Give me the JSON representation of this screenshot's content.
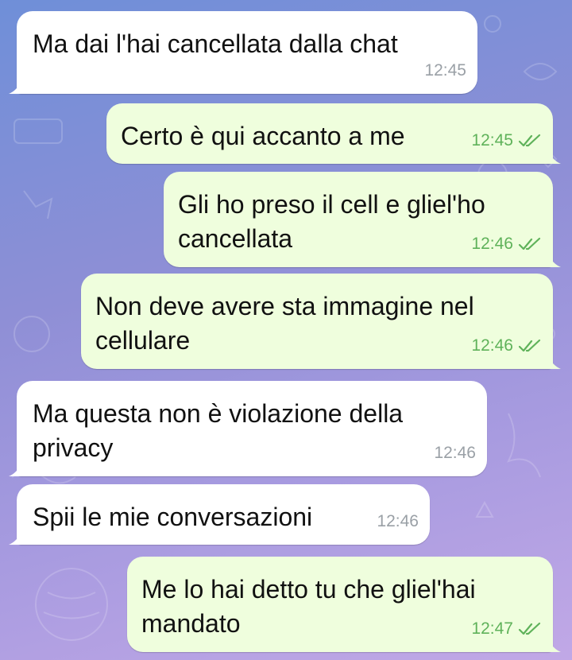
{
  "chat": {
    "messages": [
      {
        "id": "m1",
        "direction": "incoming",
        "text": "Ma dai l'hai cancellata dalla chat",
        "time": "12:45"
      },
      {
        "id": "m2",
        "direction": "outgoing",
        "text": "Certo è qui accanto a me",
        "time": "12:45",
        "status_icon": "double-check-icon"
      },
      {
        "id": "m3",
        "direction": "outgoing",
        "text": "Gli ho preso il cell e gliel'ho cancellata",
        "time": "12:46",
        "status_icon": "double-check-icon"
      },
      {
        "id": "m4",
        "direction": "outgoing",
        "text": "Non deve avere sta immagine nel cellulare",
        "time": "12:46",
        "status_icon": "double-check-icon"
      },
      {
        "id": "m5",
        "direction": "incoming",
        "text": "Ma questa non è violazione della privacy",
        "time": "12:46"
      },
      {
        "id": "m6",
        "direction": "incoming",
        "text": "Spii le mie conversazioni",
        "time": "12:46"
      },
      {
        "id": "m7",
        "direction": "outgoing",
        "text": "Me lo hai detto tu che gliel'hai mandato",
        "time": "12:47",
        "status_icon": "double-check-icon"
      }
    ]
  },
  "colors": {
    "incoming_bubble": "#ffffff",
    "outgoing_bubble": "#effedd",
    "read_ticks": "#5fb25a",
    "timestamp_incoming": "#9aa0a6"
  }
}
